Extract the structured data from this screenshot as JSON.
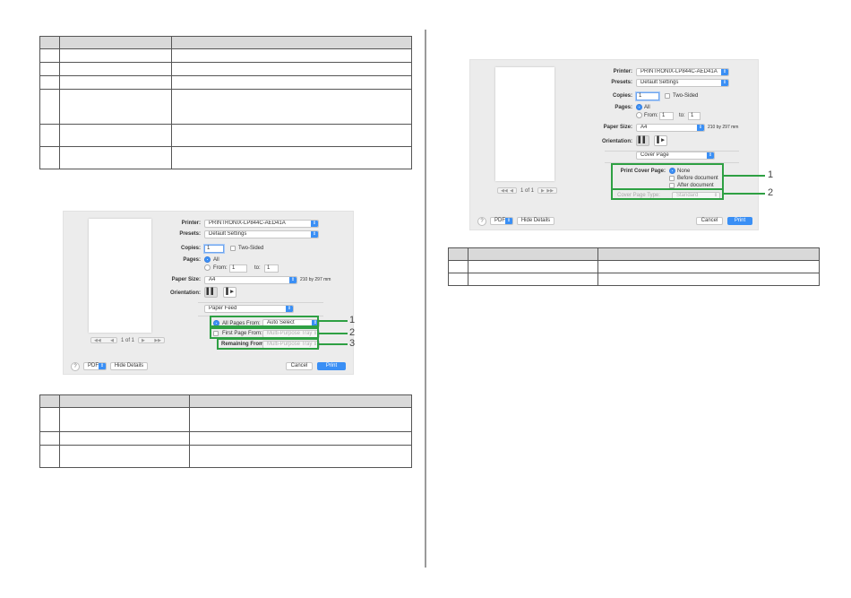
{
  "colors": {
    "callout_green": "#2ea043",
    "accent_blue": "#3a8ff5",
    "table_header": "#d9d9d9"
  },
  "left_dialog": {
    "printer_label": "Printer:",
    "printer_value": "PRINTRONIX-LP844C-AED41A",
    "presets_label": "Presets:",
    "presets_value": "Default Settings",
    "copies_label": "Copies:",
    "copies_value": "1",
    "two_sided": "Two-Sided",
    "pages_label": "Pages:",
    "pages_all": "All",
    "from_label": "From:",
    "from_value": "1",
    "to_label": "to:",
    "to_value": "1",
    "paper_size_label": "Paper Size:",
    "paper_size_value": "A4",
    "paper_dims": "210 by 297 mm",
    "orientation_label": "Orientation:",
    "section_value": "Paper Feed",
    "all_pages_from_label": "All Pages From:",
    "all_pages_from_value": "Auto Select",
    "first_page_from_label": "First Page From:",
    "first_page_from_value": "Multi-Purpose Tray",
    "remaining_from_label": "Remaining From:",
    "remaining_from_value": "Multi-Purpose Tray",
    "page_indicator": "1 of 1",
    "help": "?",
    "pdf": "PDF",
    "hide_details": "Hide Details",
    "cancel": "Cancel",
    "print": "Print",
    "callouts": [
      "1",
      "2",
      "3"
    ]
  },
  "right_dialog": {
    "printer_label": "Printer:",
    "printer_value": "PRINTRONIX-LP844C-AED41A",
    "presets_label": "Presets:",
    "presets_value": "Default Settings",
    "copies_label": "Copies:",
    "copies_value": "1",
    "two_sided": "Two-Sided",
    "pages_label": "Pages:",
    "pages_all": "All",
    "from_label": "From:",
    "from_value": "1",
    "to_label": "to:",
    "to_value": "1",
    "paper_size_label": "Paper Size:",
    "paper_size_value": "A4",
    "paper_dims": "210 by 297 mm",
    "orientation_label": "Orientation:",
    "section_value": "Cover Page",
    "print_cover_page_label": "Print Cover Page:",
    "opt_none": "None",
    "opt_before": "Before document",
    "opt_after": "After document",
    "cover_page_type_label": "Cover Page Type:",
    "cover_page_type_value": "Standard",
    "page_indicator": "1 of 1",
    "help": "?",
    "pdf": "PDF",
    "hide_details": "Hide Details",
    "cancel": "Cancel",
    "print": "Print",
    "callouts": [
      "1",
      "2"
    ]
  }
}
